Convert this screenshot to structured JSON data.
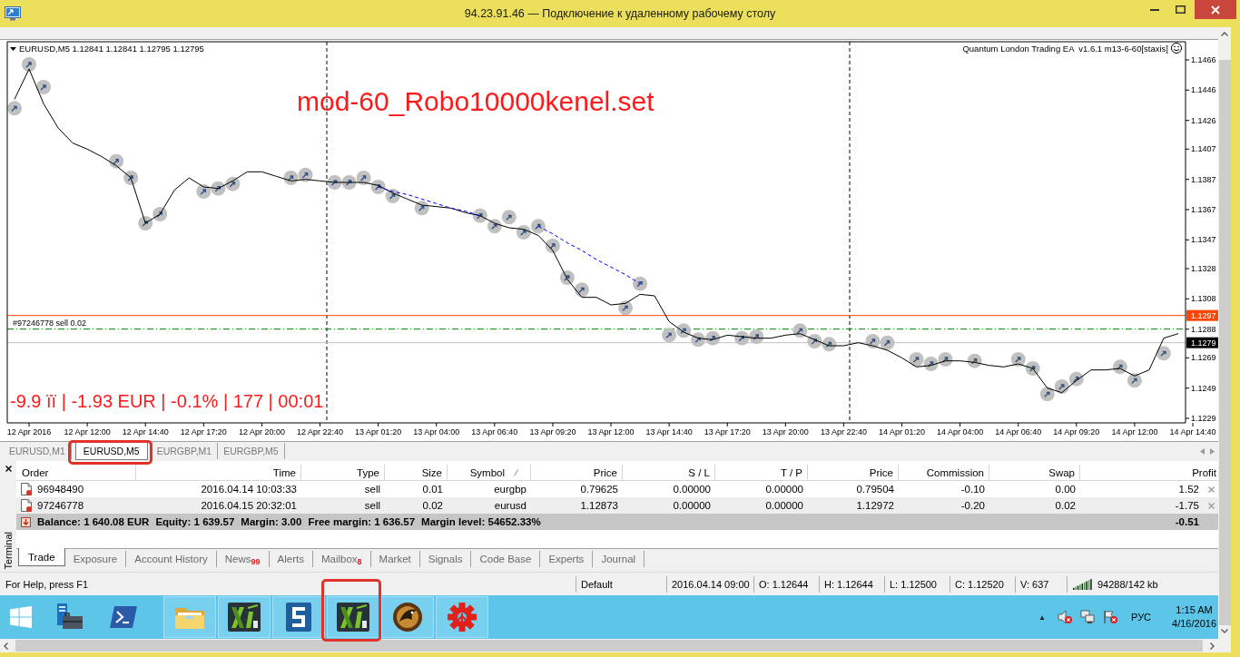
{
  "window": {
    "title": "94.23.91.46 — Подключение к удаленному рабочему столу"
  },
  "chart": {
    "header": "EURUSD,M5 1.12841 1.12841 1.12795 1.12795",
    "ea_label": "Quantum London Trading EA  v1.6.1 m13-6-60[staxis]",
    "set_name": "mod-60_Robo10000kenel.set",
    "stats": "-9.9 ïï | -1.93 EUR | -0.1% | 177 | 00:01",
    "chart_data": {
      "type": "line",
      "categories": [
        null,
        "12 Apr 2016",
        null,
        null,
        null,
        "12 Apr 12:00",
        null,
        null,
        null,
        "12 Apr 14:40",
        null,
        null,
        null,
        "12 Apr 17:20",
        null,
        null,
        null,
        "12 Apr 20:00",
        null,
        null,
        null,
        "12 Apr 22:40",
        null,
        null,
        null,
        "13 Apr 01:20",
        null,
        null,
        null,
        "13 Apr 04:00",
        null,
        null,
        null,
        "13 Apr 06:40",
        null,
        null,
        null,
        "13 Apr 09:20",
        null,
        null,
        null,
        "13 Apr 12:00",
        null,
        null,
        null,
        "13 Apr 14:40",
        null,
        null,
        null,
        "13 Apr 17:20",
        null,
        null,
        null,
        "13 Apr 20:00",
        null,
        null,
        null,
        "13 Apr 22:40",
        null,
        null,
        null,
        "14 Apr 01:20",
        null,
        null,
        null,
        "14 Apr 04:00",
        null,
        null,
        null,
        "14 Apr 06:40",
        null,
        null,
        null,
        "14 Apr 09:20",
        null,
        null,
        null,
        "14 Apr 12:00",
        null,
        null,
        null,
        "14 Apr 14:40"
      ],
      "series": [
        {
          "type": "line",
          "color": "#000000",
          "values": [
            1.144,
            1.146,
            1.1437,
            1.1421,
            1.1411,
            1.1407,
            1.1402,
            1.1396,
            1.1388,
            1.1358,
            1.1364,
            1.138,
            1.1388,
            1.1382,
            1.1381,
            1.1386,
            1.1392,
            1.1392,
            1.1389,
            1.1386,
            1.1387,
            1.1386,
            1.1385,
            1.1385,
            1.1385,
            1.1383,
            1.1378,
            1.1374,
            1.137,
            1.1369,
            1.1368,
            1.1365,
            1.1363,
            1.1358,
            1.1355,
            1.1354,
            1.135,
            1.134,
            1.1321,
            1.1309,
            1.1309,
            1.1304,
            1.1305,
            1.1311,
            1.131,
            1.1293,
            1.1286,
            1.1282,
            1.1281,
            1.1284,
            1.1283,
            1.1282,
            1.1282,
            1.1284,
            1.1285,
            1.1281,
            1.1277,
            1.1277,
            1.1279,
            1.1277,
            1.1274,
            1.1269,
            1.1263,
            1.1264,
            1.1267,
            1.1267,
            1.1266,
            1.1264,
            1.1263,
            1.1265,
            1.1262,
            1.1249,
            1.1246,
            1.1254,
            1.1261,
            1.1261,
            1.1262,
            1.1257,
            1.1261,
            1.1282,
            1.1285,
            null
          ]
        },
        {
          "type": "scatter",
          "color": "#c0c0c0",
          "values": [
            1.1434,
            1.1463,
            1.1448,
            null,
            null,
            null,
            null,
            1.1399,
            1.1388,
            1.1358,
            1.1364,
            null,
            null,
            1.1379,
            1.1381,
            1.1384,
            null,
            null,
            null,
            1.1388,
            1.139,
            null,
            1.1385,
            1.1385,
            1.1388,
            1.1382,
            1.1376,
            null,
            1.1368,
            null,
            null,
            null,
            1.1363,
            1.1356,
            1.1362,
            1.1352,
            1.1356,
            1.1343,
            1.1322,
            1.1314,
            null,
            null,
            1.1302,
            1.1318,
            null,
            1.1284,
            1.1287,
            1.1281,
            1.1282,
            null,
            1.1282,
            1.1283,
            null,
            null,
            1.1287,
            1.128,
            1.1278,
            null,
            null,
            1.128,
            1.1279,
            null,
            1.1268,
            1.1265,
            1.1268,
            null,
            1.1267,
            null,
            null,
            1.1268,
            1.1262,
            1.1245,
            1.125,
            1.1255,
            null,
            null,
            1.1263,
            1.1254,
            null,
            1.1272,
            null,
            null
          ]
        },
        {
          "type": "line",
          "color": "#0000ff",
          "line_style": "dashed",
          "values": [
            null,
            null,
            null,
            null,
            null,
            null,
            null,
            null,
            null,
            null,
            null,
            null,
            null,
            null,
            null,
            null,
            null,
            null,
            null,
            null,
            null,
            null,
            null,
            null,
            null,
            1.1382,
            1.1379,
            1.1377,
            1.1374,
            1.1371,
            1.1368,
            1.1366,
            1.1363,
            null,
            null,
            null,
            1.1356,
            1.1351,
            1.1345,
            1.134,
            1.1334,
            1.1329,
            1.1324,
            1.1318,
            null,
            null,
            null,
            null,
            null,
            null,
            null,
            null,
            null,
            null,
            null,
            null,
            null,
            null,
            null,
            null,
            null,
            null,
            null,
            null,
            null,
            null,
            null,
            null,
            null,
            null,
            null,
            null,
            null,
            null,
            null,
            null,
            null,
            null,
            null,
            null,
            null,
            null
          ]
        }
      ],
      "ylim": [
        1.1226,
        1.1478
      ],
      "yticks": [
        1.1466,
        1.1446,
        1.1426,
        1.1407,
        1.1387,
        1.1367,
        1.1347,
        1.1328,
        1.1308,
        1.1288,
        1.1269,
        1.1249,
        1.1229
      ],
      "ref_lines": [
        {
          "axis": "y",
          "value": 1.1297,
          "label": "1.1297",
          "color": "#ff4500"
        },
        {
          "axis": "y",
          "value": 1.1288,
          "label": "#97246778 sell 0.02",
          "color": "#008000",
          "line_style": "dashdot"
        },
        {
          "axis": "y",
          "value": 1.1279,
          "label": "1.1279",
          "color": "#c0c0c0"
        }
      ]
    }
  },
  "chart_tabs": [
    {
      "label": "EURUSD,M1",
      "selected": false,
      "highlighted": false
    },
    {
      "label": "EURUSD,M5",
      "selected": true,
      "highlighted": true
    },
    {
      "label": "EURGBP,M1",
      "selected": false,
      "highlighted": false
    },
    {
      "label": "EURGBP,M5",
      "selected": false,
      "highlighted": false
    }
  ],
  "terminal": {
    "title": "Terminal",
    "columns": [
      {
        "label": "Order",
        "sorted": false
      },
      {
        "label": "Time",
        "sorted": false
      },
      {
        "label": "Type",
        "sorted": false
      },
      {
        "label": "Size",
        "sorted": false
      },
      {
        "label": "Symbol",
        "sorted": true
      },
      {
        "label": "Price",
        "sorted": false
      },
      {
        "label": "S / L",
        "sorted": false
      },
      {
        "label": "T / P",
        "sorted": false
      },
      {
        "label": "Price",
        "sorted": false
      },
      {
        "label": "Commission",
        "sorted": false
      },
      {
        "label": "Swap",
        "sorted": false
      },
      {
        "label": "Profit",
        "sorted": false
      }
    ],
    "rows": [
      {
        "cells": [
          "96948490",
          "2016.04.14 10:03:33",
          "sell",
          "0.01",
          "eurgbp",
          "0.79625",
          "0.00000",
          "0.00000",
          "0.79504",
          "-0.10",
          "0.00",
          "1.52"
        ]
      },
      {
        "cells": [
          "97246778",
          "2016.04.15 20:32:01",
          "sell",
          "0.02",
          "eurusd",
          "1.12873",
          "0.00000",
          "0.00000",
          "1.12972",
          "-0.20",
          "0.02",
          "-1.75"
        ]
      }
    ],
    "summary": {
      "items": [
        "Balance: 1 640.08 EUR",
        "Equity: 1 639.57",
        "Margin: 3.00",
        "Free margin: 1 636.57",
        "Margin level: 54652.33%"
      ],
      "profit": "-0.51"
    },
    "tabs": [
      {
        "label": "Trade",
        "selected": true
      },
      {
        "label": "Exposure",
        "selected": false
      },
      {
        "label": "Account History",
        "selected": false
      },
      {
        "label": "News",
        "badge": "99",
        "selected": false
      },
      {
        "label": "Alerts",
        "selected": false
      },
      {
        "label": "Mailbox",
        "badge": "8",
        "selected": false
      },
      {
        "label": "Market",
        "selected": false
      },
      {
        "label": "Signals",
        "selected": false
      },
      {
        "label": "Code Base",
        "selected": false
      },
      {
        "label": "Experts",
        "selected": false
      },
      {
        "label": "Journal",
        "selected": false
      }
    ]
  },
  "status_bar": {
    "help": "For Help, press F1",
    "cells": [
      "Default",
      "2016.04.14 09:00",
      "O: 1.12644",
      "H: 1.12644",
      "L: 1.12500",
      "C: 1.12520",
      "V: 637"
    ],
    "traffic": "94288/142 kb"
  },
  "taskbar": {
    "items": [
      {
        "kind": "start",
        "running": false,
        "highlighted": false
      },
      {
        "kind": "server",
        "running": false,
        "highlighted": false
      },
      {
        "kind": "shell",
        "running": false,
        "highlighted": false
      },
      {
        "kind": "folder",
        "running": true,
        "highlighted": false
      },
      {
        "kind": "trader",
        "running": true,
        "highlighted": false
      },
      {
        "kind": "tile",
        "running": true,
        "highlighted": false
      },
      {
        "kind": "trader",
        "running": true,
        "highlighted": true
      },
      {
        "kind": "emblem",
        "running": true,
        "highlighted": false
      },
      {
        "kind": "gear",
        "running": true,
        "highlighted": false
      }
    ],
    "tray": {
      "expand": "▲",
      "language": "РУС",
      "time": "1:15 AM",
      "date": "4/16/2016"
    }
  }
}
